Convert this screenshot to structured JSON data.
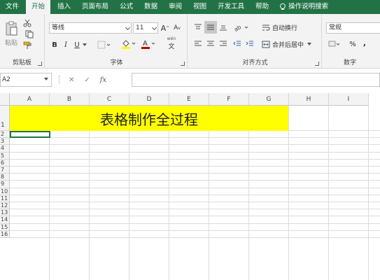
{
  "tabs": [
    "文件",
    "开始",
    "插入",
    "页面布局",
    "公式",
    "数据",
    "审阅",
    "视图",
    "开发工具",
    "帮助",
    "操作说明搜索"
  ],
  "clipboard": {
    "paste_label": "粘贴",
    "group_label": "剪贴板"
  },
  "font": {
    "name": "等线",
    "size": "11",
    "group_label": "字体",
    "grow": "A",
    "shrink": "A",
    "bold": "B",
    "italic": "I",
    "underline": "U",
    "wen": "wén"
  },
  "alignment": {
    "wrap_label": "自动换行",
    "merge_label": "合并后居中",
    "group_label": "对齐方式"
  },
  "number": {
    "format": "常规",
    "percent": "%",
    "comma": ",",
    "group_label": "数字"
  },
  "formula_bar": {
    "name_box": "A2",
    "cancel": "✕",
    "enter": "✓",
    "fx": "fx"
  },
  "columns": [
    "A",
    "B",
    "C",
    "D",
    "E",
    "F",
    "G",
    "H",
    "I"
  ],
  "rows": [
    "1",
    "2",
    "3",
    "4",
    "5",
    "6",
    "7",
    "8",
    "9",
    "10",
    "11",
    "12",
    "13",
    "14",
    "15",
    "16"
  ],
  "cell_title": "表格制作全过程",
  "colors": {
    "excel_green": "#217346",
    "highlight_yellow": "#ffff00",
    "font_red": "#c00000"
  }
}
